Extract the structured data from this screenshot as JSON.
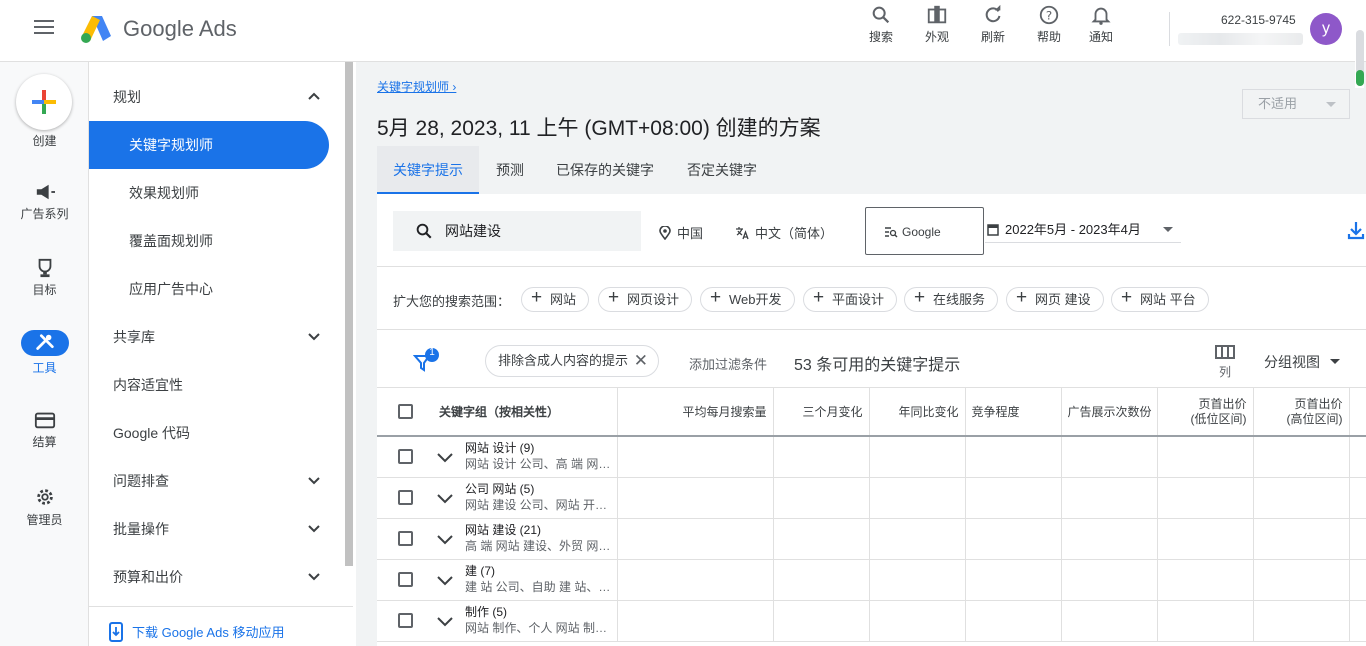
{
  "app": {
    "brand": "Google Ads"
  },
  "header": {
    "tools": [
      {
        "icon": "search-icon",
        "label": "搜索"
      },
      {
        "icon": "appearance-icon",
        "label": "外观"
      },
      {
        "icon": "refresh-icon",
        "label": "刷新"
      },
      {
        "icon": "help-icon",
        "label": "帮助"
      },
      {
        "icon": "bell-icon",
        "label": "通知"
      }
    ],
    "account_id": "622-315-9745",
    "avatar_letter": "y"
  },
  "leftnav": {
    "create_label": "创建",
    "items": [
      {
        "icon": "megaphone-icon",
        "label": "广告系列"
      },
      {
        "icon": "trophy-icon",
        "label": "目标"
      },
      {
        "icon": "tools-icon",
        "label": "工具"
      },
      {
        "icon": "credit-card-icon",
        "label": "结算"
      },
      {
        "icon": "gear-icon",
        "label": "管理员"
      }
    ]
  },
  "subnav": {
    "items": [
      {
        "label": "规划"
      },
      {
        "label": "关键字规划师"
      },
      {
        "label": "效果规划师"
      },
      {
        "label": "覆盖面规划师"
      },
      {
        "label": "应用广告中心"
      },
      {
        "label": "共享库"
      },
      {
        "label": "内容适宜性"
      },
      {
        "label": "Google 代码"
      },
      {
        "label": "问题排查"
      },
      {
        "label": "批量操作"
      },
      {
        "label": "预算和出价"
      }
    ],
    "download_app": "下载 Google Ads 移动应用"
  },
  "main": {
    "breadcrumb": "关键字规划师",
    "title": "5月 28, 2023, 11 上午 (GMT+08:00) 创建的方案",
    "status_select": "不适用",
    "tabs": [
      "关键字提示",
      "预测",
      "已保存的关键字",
      "否定关键字"
    ],
    "search": {
      "value": "网站建设"
    },
    "location": "中国",
    "language": "中文（简体）",
    "network": "Google",
    "date_range": "2022年5月 - 2023年4月",
    "expand_label": "扩大您的搜索范围：",
    "suggestions": [
      "网站",
      "网页设计",
      "Web开发",
      "平面设计",
      "在线服务",
      "网页 建设",
      "网站 平台"
    ],
    "filter_badge": "1",
    "filter_chip": "排除含成人内容的提示",
    "add_filter": "添加过滤条件",
    "keyword_count": "53 条可用的关键字提示",
    "columns_label": "列",
    "group_view": "分组视图"
  },
  "table": {
    "headers": [
      "关键字组（按相关性）",
      "平均每月搜索量",
      "三个月变化",
      "年同比变化",
      "竞争程度",
      "广告展示次数份",
      "页首出价\n(低位区间)",
      "页首出价\n(高位区间)"
    ],
    "rows": [
      {
        "title": "网站 设计 (9)",
        "sub": "网站 设计 公司、高 端 网…"
      },
      {
        "title": "公司 网站 (5)",
        "sub": "网站 建设 公司、网站 开…"
      },
      {
        "title": "网站 建设 (21)",
        "sub": "高 端 网站 建设、外贸 网…"
      },
      {
        "title": "建 (7)",
        "sub": "建 站 公司、自助 建 站、…"
      },
      {
        "title": "制作 (5)",
        "sub": "网站 制作、个人 网站 制…"
      }
    ]
  }
}
